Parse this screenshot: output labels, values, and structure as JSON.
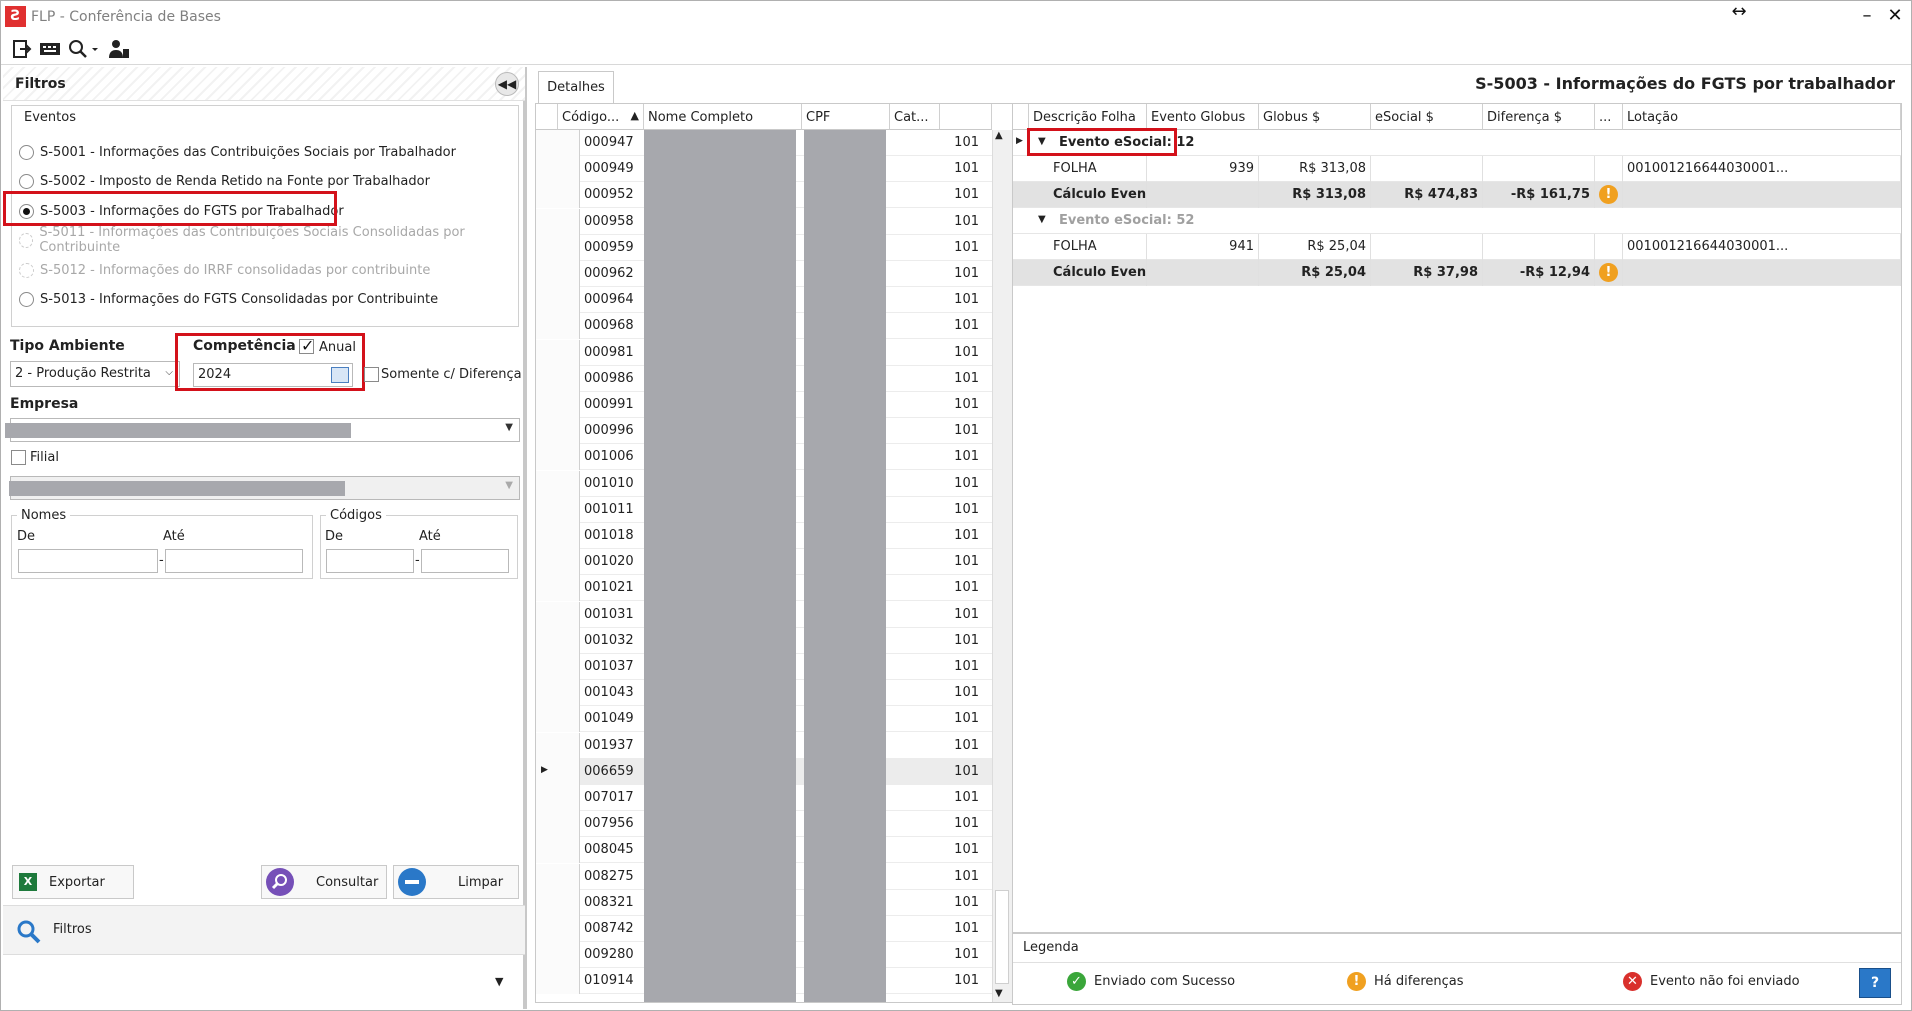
{
  "window": {
    "title": "FLP - Conferência de Bases",
    "restore_glyph": "↔",
    "minimize_glyph": "–",
    "close_glyph": "✕"
  },
  "toolbar": {
    "icons": [
      "exit-icon",
      "keyboard-icon",
      "search-icon",
      "user-icon"
    ]
  },
  "filters": {
    "title": "Filtros",
    "eventos_label": "Eventos",
    "eventos": [
      {
        "label": "S-5001 - Informações das Contribuições Sociais por Trabalhador",
        "selected": false,
        "enabled": true
      },
      {
        "label": "S-5002 - Imposto de Renda Retido na Fonte por Trabalhador",
        "selected": false,
        "enabled": true
      },
      {
        "label": "S-5003 - Informações do FGTS por Trabalhador",
        "selected": true,
        "enabled": true
      },
      {
        "label": "S-5011 - Informações das Contribuições Sociais Consolidadas por Contribuinte",
        "selected": false,
        "enabled": false
      },
      {
        "label": "S-5012 - Informações do IRRF consolidadas por contribuinte",
        "selected": false,
        "enabled": false
      },
      {
        "label": "S-5013 - Informações do FGTS Consolidadas por Contribuinte",
        "selected": false,
        "enabled": true
      }
    ],
    "tipo_ambiente_label": "Tipo Ambiente",
    "tipo_ambiente_value": "2 - Produção Restrita",
    "competencia_label": "Competência",
    "anual_label": "Anual",
    "anual_checked": true,
    "competencia_value": "2024",
    "somente_diferenca_label": "Somente c/ Diferença",
    "empresa_label": "Empresa",
    "filial_label": "Filial",
    "nomes_label": "Nomes",
    "codigos_label": "Códigos",
    "de_label": "De",
    "ate_label": "Até",
    "range_sep": "-",
    "exportar_label": "Exportar",
    "consultar_label": "Consultar",
    "limpar_label": "Limpar",
    "footer_label": "Filtros"
  },
  "details": {
    "tab_label": "Detalhes",
    "header_title": "S-5003 - Informações do FGTS por trabalhador",
    "workers_grid": {
      "columns": [
        "Código...",
        "Nome Completo",
        "CPF",
        "Cat..."
      ],
      "rows": [
        {
          "code": "000947",
          "cat": "101"
        },
        {
          "code": "000949",
          "cat": "101"
        },
        {
          "code": "000952",
          "cat": "101"
        },
        {
          "code": "000958",
          "cat": "101"
        },
        {
          "code": "000959",
          "cat": "101"
        },
        {
          "code": "000962",
          "cat": "101"
        },
        {
          "code": "000964",
          "cat": "101"
        },
        {
          "code": "000968",
          "cat": "101"
        },
        {
          "code": "000981",
          "cat": "101"
        },
        {
          "code": "000986",
          "cat": "101"
        },
        {
          "code": "000991",
          "cat": "101"
        },
        {
          "code": "000996",
          "cat": "101"
        },
        {
          "code": "001006",
          "cat": "101"
        },
        {
          "code": "001010",
          "cat": "101"
        },
        {
          "code": "001011",
          "cat": "101"
        },
        {
          "code": "001018",
          "cat": "101"
        },
        {
          "code": "001020",
          "cat": "101"
        },
        {
          "code": "001021",
          "cat": "101"
        },
        {
          "code": "001031",
          "cat": "101"
        },
        {
          "code": "001032",
          "cat": "101"
        },
        {
          "code": "001037",
          "cat": "101"
        },
        {
          "code": "001043",
          "cat": "101"
        },
        {
          "code": "001049",
          "cat": "101"
        },
        {
          "code": "001937",
          "cat": "101"
        },
        {
          "code": "006659",
          "cat": "101",
          "selected": true
        },
        {
          "code": "007017",
          "cat": "101"
        },
        {
          "code": "007956",
          "cat": "101"
        },
        {
          "code": "008045",
          "cat": "101"
        },
        {
          "code": "008275",
          "cat": "101"
        },
        {
          "code": "008321",
          "cat": "101"
        },
        {
          "code": "008742",
          "cat": "101"
        },
        {
          "code": "009280",
          "cat": "101"
        },
        {
          "code": "010914",
          "cat": "101"
        }
      ]
    },
    "events_grid": {
      "columns": [
        "Descrição Folha",
        "Evento Globus",
        "Globus $",
        "eSocial $",
        "Diferença $",
        "...",
        "Lotação"
      ],
      "groups": [
        {
          "title": "Evento eSocial: 12",
          "folha": {
            "desc": "FOLHA",
            "evento": "939",
            "globus": "R$ 313,08",
            "lotacao": "001001216644030001..."
          },
          "calc": {
            "desc": "Cálculo Even...",
            "globus": "R$ 313,08",
            "esocial": "R$ 474,83",
            "diff": "-R$ 161,75"
          }
        },
        {
          "title": "Evento eSocial: 52",
          "folha": {
            "desc": "FOLHA",
            "evento": "941",
            "globus": "R$ 25,04",
            "lotacao": "001001216644030001..."
          },
          "calc": {
            "desc": "Cálculo Even...",
            "globus": "R$ 25,04",
            "esocial": "R$ 37,98",
            "diff": "-R$ 12,94"
          }
        }
      ]
    },
    "legend": {
      "title": "Legenda",
      "enviado": "Enviado com Sucesso",
      "diferencas": "Há diferenças",
      "nao_enviado": "Evento não foi enviado"
    }
  },
  "colors": {
    "highlight_box": "#d3111a",
    "warning": "#f0a020",
    "success": "#3aa63a",
    "error": "#d9302c"
  }
}
